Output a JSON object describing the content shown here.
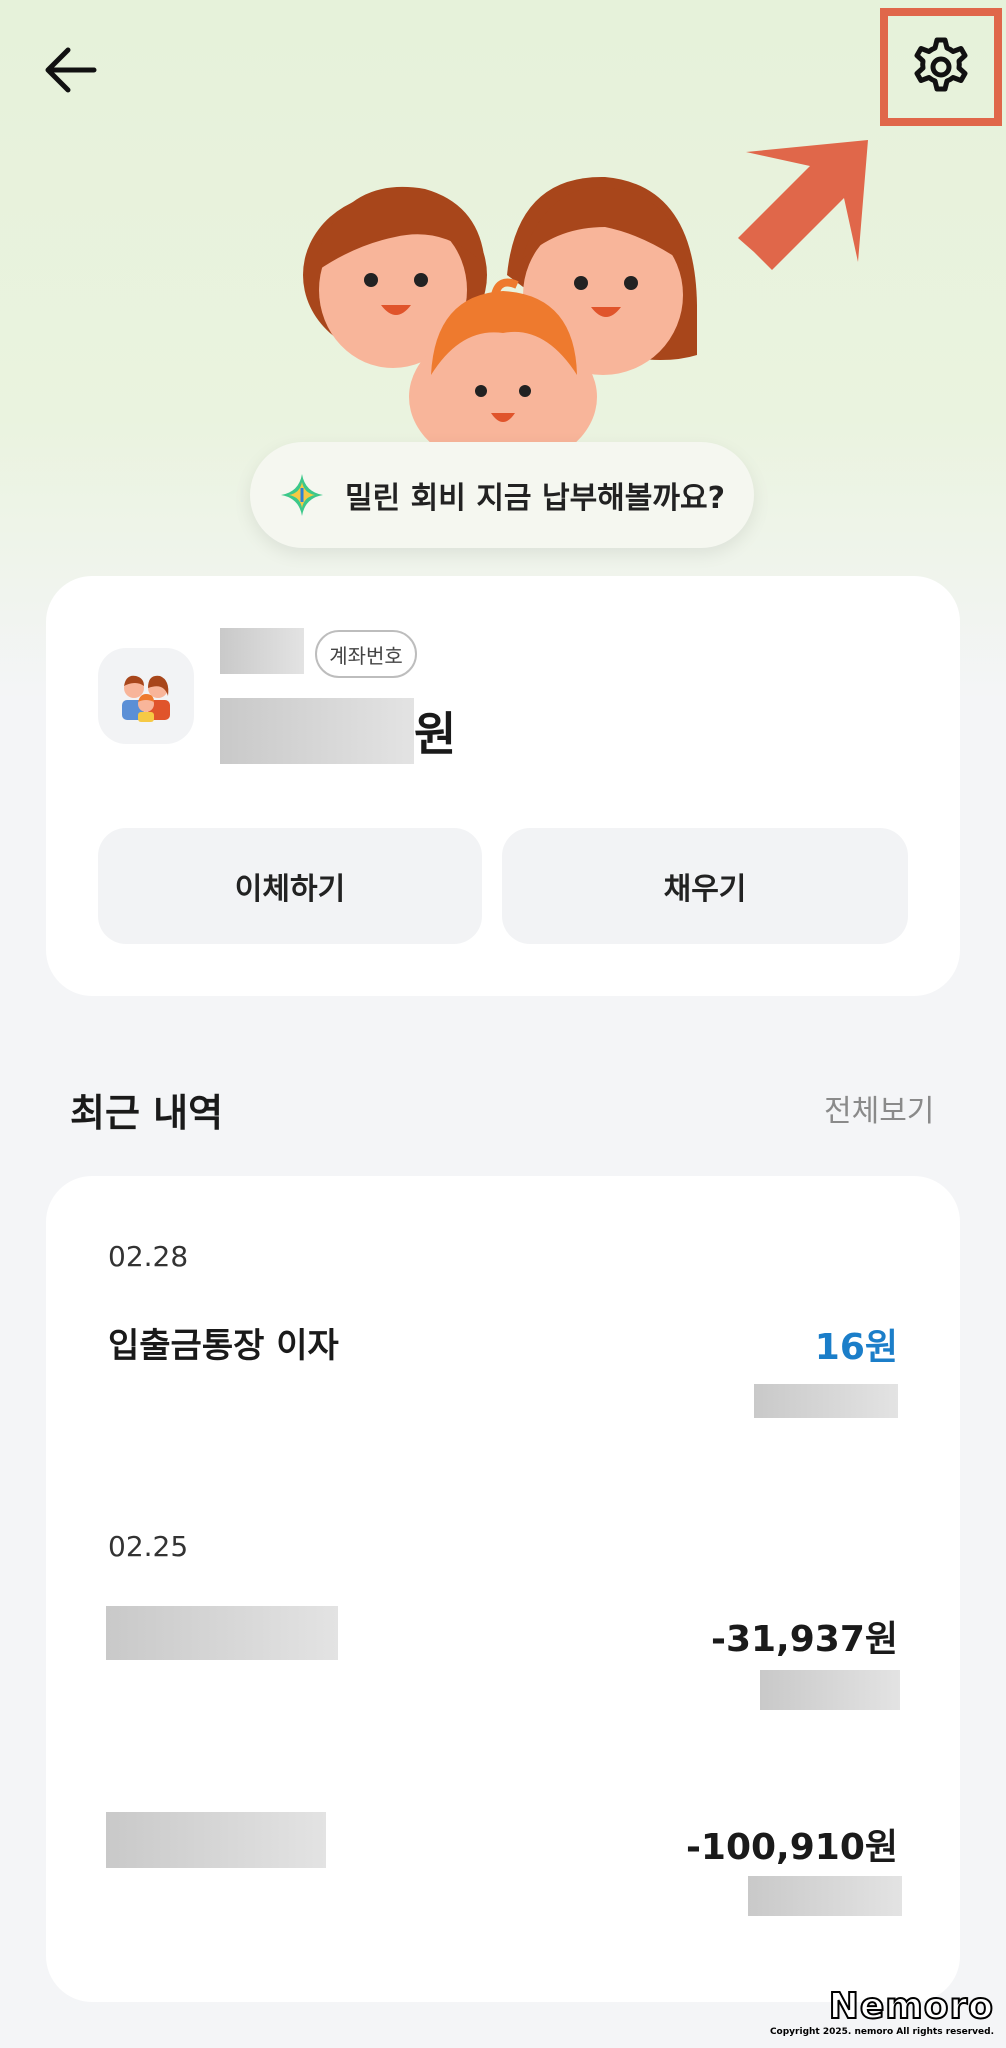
{
  "banner": {
    "text": "밀린 회비 지금 납부해볼까요?"
  },
  "account": {
    "badge_label": "계좌번호",
    "currency_suffix": "원",
    "transfer_label": "이체하기",
    "fill_label": "채우기"
  },
  "recent": {
    "title": "최근 내역",
    "view_all_label": "전체보기",
    "groups": [
      {
        "date": "02.28",
        "title": "입출금통장 이자",
        "amount": "16원",
        "positive": true
      },
      {
        "date": "02.25",
        "amount": "-31,937원",
        "positive": false
      },
      {
        "amount": "-100,910원",
        "positive": false
      }
    ]
  },
  "watermark": {
    "logo": "Nemoro",
    "copyright": "Copyright 2025. nemoro All rights reserved."
  },
  "colors": {
    "accent_positive": "#1b7ec9",
    "annotation": "#e0674a",
    "hero_bg": "#e6f2da"
  },
  "icons": [
    "back-arrow-icon",
    "settings-gear-icon",
    "annotation-arrow-icon",
    "sparkle-icon",
    "family-icon"
  ]
}
